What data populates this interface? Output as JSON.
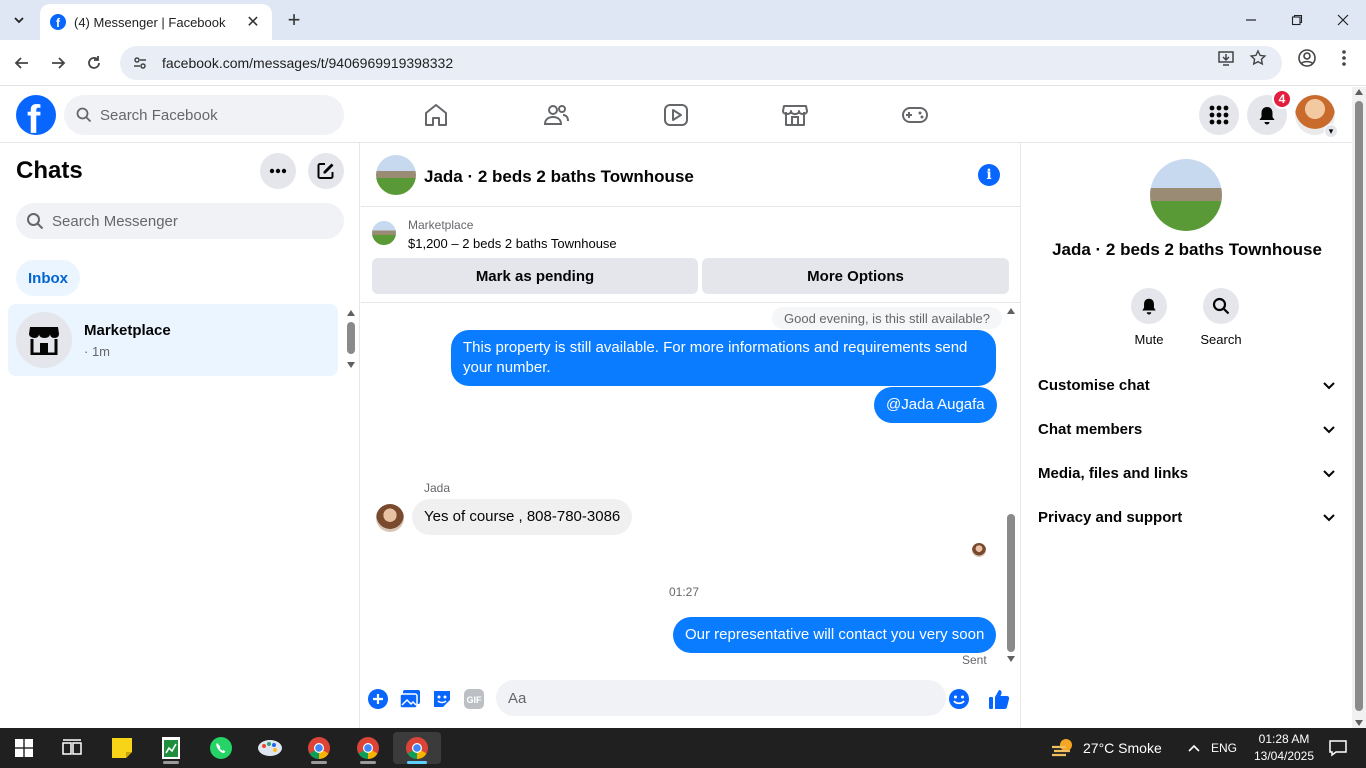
{
  "browser": {
    "tab_title": "(4) Messenger | Facebook",
    "url": "facebook.com/messages/t/9406969919398332"
  },
  "fb_header": {
    "search_placeholder": "Search Facebook",
    "notification_count": "4"
  },
  "sidebar": {
    "title": "Chats",
    "search_placeholder": "Search Messenger",
    "filter_label": "Inbox",
    "chats": [
      {
        "name": "Marketplace",
        "time": "· 1m"
      }
    ]
  },
  "conversation": {
    "title": "Jada · 2 beds 2 baths Townhouse",
    "marketplace_label": "Marketplace",
    "listing": "$1,200 – 2 beds 2 baths Townhouse",
    "mark_pending_label": "Mark as pending",
    "more_options_label": "More Options",
    "quoted_text": "Good evening, is this still available?",
    "messages": [
      {
        "from": "me",
        "text": "This property is still available. For more informations and requirements send your number."
      },
      {
        "from": "me",
        "text": "@Jada Augafa"
      },
      {
        "from": "Jada",
        "text": "Yes of course , 808-780-3086"
      },
      {
        "from": "me",
        "text": "Our representative will contact you very soon"
      }
    ],
    "sender_name": "Jada",
    "timestamp": "01:27",
    "status": "Sent",
    "composer_placeholder": "Aa",
    "gif_label": "GIF"
  },
  "details": {
    "title": "Jada · 2 beds 2 baths Townhouse",
    "mute_label": "Mute",
    "search_label": "Search",
    "sections": [
      "Customise chat",
      "Chat members",
      "Media, files and links",
      "Privacy and support"
    ]
  },
  "taskbar": {
    "weather": "27°C  Smoke",
    "lang": "ENG",
    "time": "01:28 AM",
    "date": "13/04/2025"
  },
  "colors": {
    "fb_blue": "#0866ff",
    "bubble_blue": "#0a7cff",
    "badge_red": "#e41e3f"
  }
}
